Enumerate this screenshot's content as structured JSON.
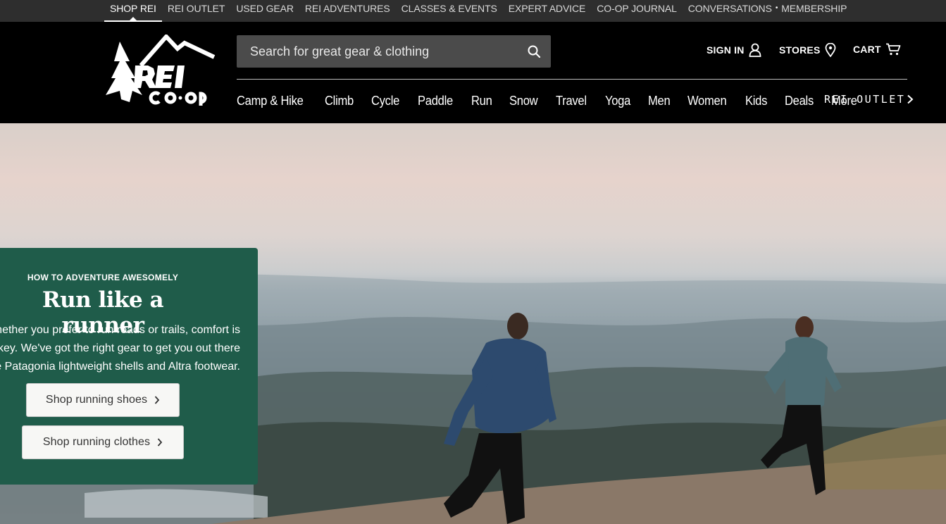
{
  "topbar": {
    "items": [
      {
        "label": "SHOP REI",
        "active": true
      },
      {
        "label": "REI OUTLET"
      },
      {
        "label": "USED GEAR"
      },
      {
        "label": "REI ADVENTURES"
      },
      {
        "label": "CLASSES & EVENTS"
      },
      {
        "label": "EXPERT ADVICE"
      },
      {
        "label": "CO-OP JOURNAL"
      },
      {
        "label": "CONVERSATIONS"
      },
      {
        "label": "MEMBERSHIP"
      }
    ],
    "separator": "•"
  },
  "header": {
    "logo_alt": "REI CO-OP",
    "search_placeholder": "Search for great gear & clothing",
    "sign_in": "SIGN IN",
    "stores": "STORES",
    "cart": "CART"
  },
  "nav": {
    "items": [
      "Camp & Hike",
      "Climb",
      "Cycle",
      "Paddle",
      "Run",
      "Snow",
      "Travel",
      "Yoga",
      "Men",
      "Women",
      "Kids",
      "Deals",
      "More"
    ],
    "outlet_label": "REI OUTLET"
  },
  "promo": {
    "eyebrow": "HOW TO ADVENTURE AWESOMELY",
    "title": "Run like a runner",
    "body_lines": [
      "Whether you prefer to run roads or trails, comfort is",
      "key. We've got the right gear to get you out there",
      "like Patagonia lightweight shells and Altra footwear."
    ],
    "button_shoes": "Shop running shoes",
    "button_clothes": "Shop running clothes"
  },
  "colors": {
    "topbar_bg": "#2e2e2e",
    "header_bg": "#000000",
    "promo_bg": "#1f5c4a",
    "search_bg": "#4b4b4b"
  }
}
